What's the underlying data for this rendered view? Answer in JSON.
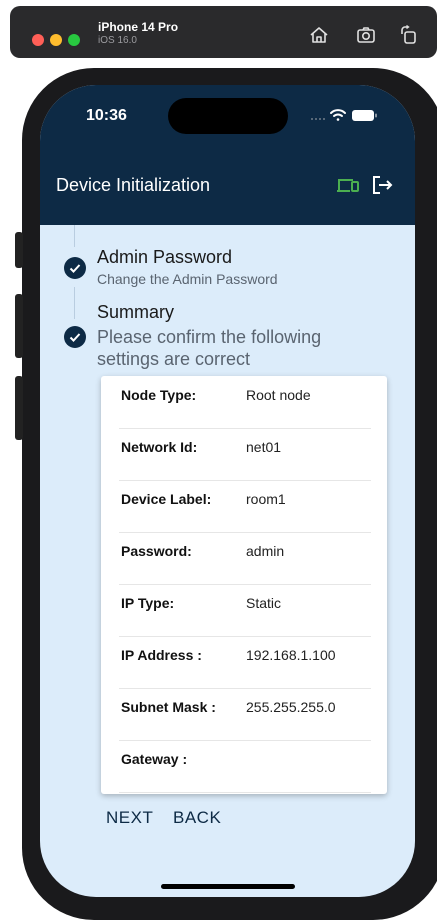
{
  "simulator": {
    "device_name": "iPhone 14 Pro",
    "os_version": "iOS 16.0",
    "icons": [
      "home-icon",
      "screenshot-icon",
      "rotate-icon"
    ]
  },
  "status_bar": {
    "time": "10:36",
    "icons": [
      "signal-icon",
      "wifi-icon",
      "battery-icon"
    ]
  },
  "header": {
    "title": "Device Initialization",
    "icons": [
      "devices-icon",
      "logout-icon"
    ],
    "accent_color": "#4caf50",
    "background_color": "#0d2a45"
  },
  "steps": [
    {
      "title": "Admin Password",
      "subtitle": "Change the Admin Password",
      "completed": true
    },
    {
      "title": "Summary",
      "subtitle_line1": "Please confirm the following",
      "subtitle_line2": "settings are correct",
      "completed": true
    }
  ],
  "summary": {
    "rows": [
      {
        "label": "Node Type:",
        "value": "Root node"
      },
      {
        "label": "Network Id:",
        "value": "net01"
      },
      {
        "label": "Device Label:",
        "value": "room1"
      },
      {
        "label": "Password:",
        "value": "admin"
      },
      {
        "label": "IP Type:",
        "value": "Static"
      },
      {
        "label": "IP Address :",
        "value": "192.168.1.100"
      },
      {
        "label": "Subnet Mask :",
        "value": "255.255.255.0"
      },
      {
        "label": "Gateway :",
        "value": ""
      }
    ]
  },
  "actions": {
    "next_label": "NEXT",
    "back_label": "BACK"
  }
}
